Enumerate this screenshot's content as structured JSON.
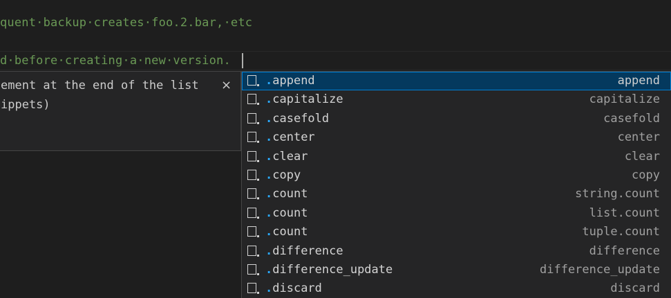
{
  "editor": {
    "line1": "quent·backup·creates·foo.2.bar,·etc",
    "line2": "d·before·creating·a·new·version."
  },
  "detail": {
    "line1": "ement at the end of the list",
    "line2": "ippets)",
    "close": "×"
  },
  "suggest": {
    "match_prefix": ".",
    "items": [
      {
        "label": "append",
        "detail": "append",
        "icon": "method-icon",
        "selected": true
      },
      {
        "label": "capitalize",
        "detail": "capitalize",
        "icon": "method-icon"
      },
      {
        "label": "casefold",
        "detail": "casefold",
        "icon": "method-icon"
      },
      {
        "label": "center",
        "detail": "center",
        "icon": "method-icon"
      },
      {
        "label": "clear",
        "detail": "clear",
        "icon": "method-icon"
      },
      {
        "label": "copy",
        "detail": "copy",
        "icon": "method-icon"
      },
      {
        "label": "count",
        "detail": "string.count",
        "icon": "method-icon"
      },
      {
        "label": "count",
        "detail": "list.count",
        "icon": "method-icon"
      },
      {
        "label": "count",
        "detail": "tuple.count",
        "icon": "method-icon"
      },
      {
        "label": "difference",
        "detail": "difference",
        "icon": "method-icon"
      },
      {
        "label": "difference_update",
        "detail": "difference_update",
        "icon": "method-icon"
      },
      {
        "label": "discard",
        "detail": "discard",
        "icon": "method-icon"
      }
    ]
  }
}
